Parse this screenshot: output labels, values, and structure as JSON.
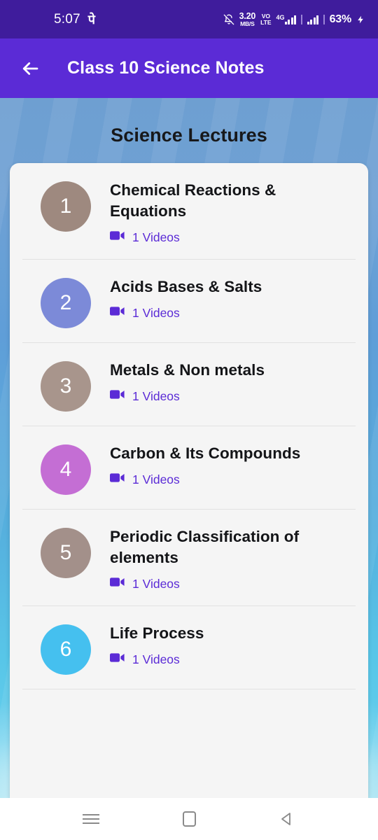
{
  "status_bar": {
    "time": "5:07",
    "ampm": "पे",
    "notification_icon": "bell-off-icon",
    "data_speed_value": "3.20",
    "data_speed_unit": "MB/S",
    "volte_line1": "VO",
    "volte_line2": "LTE",
    "network_type": "4G",
    "battery": "63%",
    "charging_icon": "lightning-bolt-icon"
  },
  "app_bar": {
    "back_icon": "arrow-left-icon",
    "title": "Class 10 Science Notes"
  },
  "page": {
    "title": "Science Lectures"
  },
  "lectures": [
    {
      "number": "1",
      "title": "Chemical Reactions & Equations",
      "videos": "1 Videos",
      "badge_color": "#9e897f"
    },
    {
      "number": "2",
      "title": "Acids Bases & Salts",
      "videos": "1 Videos",
      "badge_color": "#7c8ad8"
    },
    {
      "number": "3",
      "title": "Metals & Non metals",
      "videos": "1 Videos",
      "badge_color": "#a8958c"
    },
    {
      "number": "4",
      "title": "Carbon & Its Compounds",
      "videos": "1 Videos",
      "badge_color": "#c46ed4"
    },
    {
      "number": "5",
      "title": "Periodic Classification of elements",
      "videos": "1 Videos",
      "badge_color": "#a3908a"
    },
    {
      "number": "6",
      "title": "Life Process",
      "videos": "1 Videos",
      "badge_color": "#45c0ef"
    }
  ],
  "video_icon_name": "video-camera-icon",
  "nav_bar": {
    "recents_icon": "hamburger-menu-icon",
    "home_icon": "home-square-icon",
    "back_icon": "back-triangle-icon"
  },
  "colors": {
    "status_bar": "#3f1c9c",
    "app_bar": "#5b2bd6",
    "accent_purple": "#5b2bd6",
    "card_bg": "#f5f5f5"
  }
}
